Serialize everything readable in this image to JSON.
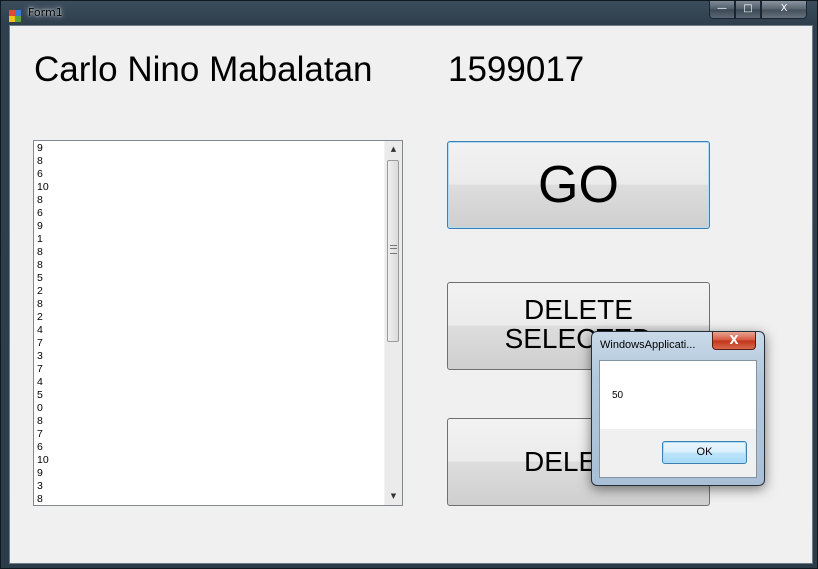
{
  "window": {
    "title": "Form1",
    "minimize_glyph": "—",
    "maximize_glyph": "□",
    "close_glyph": "X"
  },
  "form": {
    "name_label": "Carlo Nino Mabalatan",
    "id_label": "1599017",
    "go_button": "GO",
    "delete_selected_button": "DELETE SELECTED",
    "delete_button": "DELETE"
  },
  "listbox": {
    "items": [
      "9",
      "8",
      "6",
      "10",
      "8",
      "6",
      "9",
      "1",
      "8",
      "8",
      "5",
      "2",
      "8",
      "2",
      "4",
      "7",
      "3",
      "7",
      "4",
      "5",
      "0",
      "8",
      "7",
      "6",
      "10",
      "9",
      "3",
      "8"
    ],
    "scroll_up_glyph": "▲",
    "scroll_down_glyph": "▼",
    "scroll_position": 0.0
  },
  "messagebox": {
    "title": "WindowsApplicati...",
    "message": "50",
    "ok_button": "OK",
    "close_glyph": "X"
  },
  "icons": {
    "app_icon": "form-icon",
    "colors": [
      "#e04a2e",
      "#3a7bd5",
      "#f0c020",
      "#5aa43c"
    ]
  }
}
